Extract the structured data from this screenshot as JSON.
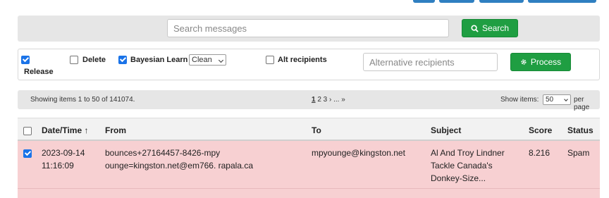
{
  "search": {
    "placeholder": "Search messages",
    "button_label": "Search"
  },
  "options": {
    "release": {
      "label": "Release",
      "checked": true
    },
    "delete": {
      "label": "Delete",
      "checked": false
    },
    "bayesian": {
      "label": "Bayesian Learn",
      "checked": true,
      "mode": "Clean"
    },
    "alt_recipients": {
      "label": "Alt recipients",
      "checked": false,
      "placeholder": "Alternative recipients"
    },
    "process_label": "Process"
  },
  "pager": {
    "info": "Showing items 1 to 50 of 141074.",
    "current": "1",
    "rest": " 2 3 › ... »",
    "show_items_label": "Show items:",
    "per_page_value": "50",
    "per_page_label": "per page"
  },
  "table": {
    "columns": [
      "Date/Time ↑",
      "From",
      "To",
      "Subject",
      "Score",
      "Status"
    ],
    "rows": [
      {
        "checked": true,
        "date": "2023-09-14",
        "time": "11:16:09",
        "from1": "bounces+27164457-8426-mpy",
        "from2": "ounge=kingston.net@em766. rapala.ca",
        "to": "mpyounge@kingston.net",
        "subject1": "Al And Troy Lindner",
        "subject2": "Tackle Canada's",
        "subject3": "Donkey-Size...",
        "score": "8.216",
        "status": "Spam"
      }
    ]
  },
  "colors": {
    "accent_green": "#1f9e42",
    "row_highlight": "#f7d0d2",
    "checkbox_blue": "#1a73e8"
  }
}
